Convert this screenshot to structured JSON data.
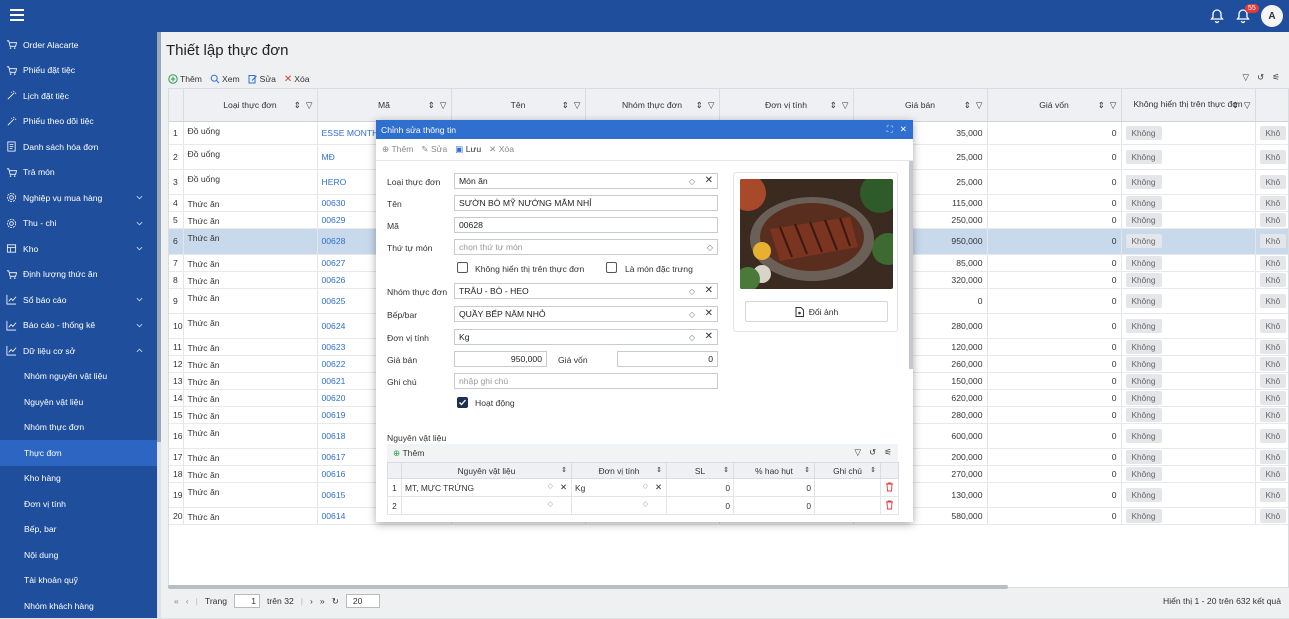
{
  "topbar": {
    "badge_count": "55",
    "avatar": "A"
  },
  "sidebar": {
    "items": [
      {
        "label": "Order Alacarte",
        "icon": "cart-icon",
        "name": "order-alacarte"
      },
      {
        "label": "Phiếu đặt tiệc",
        "icon": "cart-icon",
        "name": "phieu-dat-tiec"
      },
      {
        "label": "Lịch đặt tiệc",
        "icon": "wand-icon",
        "name": "lich-dat-tiec"
      },
      {
        "label": "Phiếu theo dõi tiệc",
        "icon": "wand-icon",
        "name": "phieu-theo-doi-tiec"
      },
      {
        "label": "Danh sách hóa đơn",
        "icon": "receipt-icon",
        "name": "danh-sach-hoa-don"
      },
      {
        "label": "Trả món",
        "icon": "cart-icon",
        "name": "tra-mon"
      },
      {
        "label": "Nghiệp vụ mua hàng",
        "icon": "gear-icon",
        "name": "nghiep-vu-mua-hang",
        "chev": "down"
      },
      {
        "label": "Thu - chi",
        "icon": "gear-icon",
        "name": "thu-chi",
        "chev": "down"
      },
      {
        "label": "Kho",
        "icon": "box-icon",
        "name": "kho",
        "chev": "down"
      },
      {
        "label": "Định lượng thức ăn",
        "icon": "cart-icon",
        "name": "dinh-luong-thuc-an"
      },
      {
        "label": "Sổ báo cáo",
        "icon": "chart-icon",
        "name": "so-bao-cao",
        "chev": "down"
      },
      {
        "label": "Báo cáo - thống kê",
        "icon": "chart-icon",
        "name": "bao-cao-thong-ke",
        "chev": "down"
      },
      {
        "label": "Dữ liệu cơ sở",
        "icon": "chart-icon",
        "name": "du-lieu-co-so",
        "chev": "up"
      }
    ],
    "subitems": [
      "Nhóm nguyên vật liệu",
      "Nguyên vật liệu",
      "Nhóm thực đơn",
      "Thực đơn",
      "Kho hàng",
      "Đơn vị tính",
      "Bếp, bar",
      "Nội dung",
      "Tài khoản quỹ",
      "Nhóm khách hàng"
    ],
    "active_sub": 3
  },
  "page": {
    "title": "Thiết lập thực đơn"
  },
  "toolbar": {
    "add": "Thêm",
    "view": "Xem",
    "edit": "Sửa",
    "delete": "Xóa"
  },
  "table": {
    "columns": [
      "Loại thực đơn",
      "Mã",
      "Tên",
      "Nhóm thực đơn",
      "Đơn vị tính",
      "Giá bán",
      "Giá vốn",
      "Không hiển thị trên thực đơn"
    ],
    "rows": [
      {
        "n": "1",
        "type": "Đồ uống",
        "code": "ESSE MONTH",
        "price": "35,000",
        "cost": "0",
        "flag": "Không"
      },
      {
        "n": "2",
        "type": "Đồ uống",
        "code": "MĐ",
        "price": "25,000",
        "cost": "0",
        "flag": "Không"
      },
      {
        "n": "3",
        "type": "Đồ uống",
        "code": "HERO",
        "price": "25,000",
        "cost": "0",
        "flag": "Không"
      },
      {
        "n": "4",
        "type": "Thức ăn",
        "code": "00630",
        "price": "115,000",
        "cost": "0",
        "flag": "Không"
      },
      {
        "n": "5",
        "type": "Thức ăn",
        "code": "00629",
        "price": "250,000",
        "cost": "0",
        "flag": "Không"
      },
      {
        "n": "6",
        "type": "Thức ăn",
        "code": "00628",
        "price": "950,000",
        "cost": "0",
        "flag": "Không"
      },
      {
        "n": "7",
        "type": "Thức ăn",
        "code": "00627",
        "price": "85,000",
        "cost": "0",
        "flag": "Không"
      },
      {
        "n": "8",
        "type": "Thức ăn",
        "code": "00626",
        "price": "320,000",
        "cost": "0",
        "flag": "Không"
      },
      {
        "n": "9",
        "type": "Thức ăn",
        "code": "00625",
        "price": "0",
        "cost": "0",
        "flag": "Không"
      },
      {
        "n": "10",
        "type": "Thức ăn",
        "code": "00624",
        "price": "280,000",
        "cost": "0",
        "flag": "Không"
      },
      {
        "n": "11",
        "type": "Thức ăn",
        "code": "00623",
        "price": "120,000",
        "cost": "0",
        "flag": "Không"
      },
      {
        "n": "12",
        "type": "Thức ăn",
        "code": "00622",
        "price": "260,000",
        "cost": "0",
        "flag": "Không"
      },
      {
        "n": "13",
        "type": "Thức ăn",
        "code": "00621",
        "price": "150,000",
        "cost": "0",
        "flag": "Không"
      },
      {
        "n": "14",
        "type": "Thức ăn",
        "code": "00620",
        "price": "620,000",
        "cost": "0",
        "flag": "Không"
      },
      {
        "n": "15",
        "type": "Thức ăn",
        "code": "00619",
        "price": "280,000",
        "cost": "0",
        "flag": "Không"
      },
      {
        "n": "16",
        "type": "Thức ăn",
        "code": "00618",
        "price": "600,000",
        "cost": "0",
        "flag": "Không"
      },
      {
        "n": "17",
        "type": "Thức ăn",
        "code": "00617",
        "price": "200,000",
        "cost": "0",
        "flag": "Không"
      },
      {
        "n": "18",
        "type": "Thức ăn",
        "code": "00616",
        "price": "270,000",
        "cost": "0",
        "flag": "Không"
      },
      {
        "n": "19",
        "type": "Thức ăn",
        "code": "00615",
        "price": "130,000",
        "cost": "0",
        "flag": "Không"
      },
      {
        "n": "20",
        "type": "Thức ăn",
        "code": "00614",
        "price": "580,000",
        "cost": "0",
        "flag": "Không"
      }
    ],
    "selected_row": 5,
    "extra_col": "Khô"
  },
  "pager": {
    "page_label": "Trang",
    "page": "1",
    "of_label": "trên 32",
    "page_size": "20",
    "summary": "Hiển thị 1 - 20 trên 632 kết quả"
  },
  "modal": {
    "title": "Chỉnh sửa thông tin",
    "toolbar": {
      "add": "Thêm",
      "edit": "Sửa",
      "save": "Lưu",
      "delete": "Xóa"
    },
    "labels": {
      "type": "Loại thực đơn",
      "name": "Tên",
      "code": "Mã",
      "order": "Thứ tự món",
      "group": "Nhóm thực đơn",
      "kitchen": "Bếp/bar",
      "unit": "Đơn vị tính",
      "price": "Giá bán",
      "cost": "Giá vốn",
      "note": "Ghi chú",
      "hide": "Không hiển thị trên thực đơn",
      "special": "Là món đặc trưng",
      "active": "Hoạt động",
      "materials": "Nguyên vật liệu",
      "change_image": "Đổi ảnh"
    },
    "values": {
      "type": "Món ăn",
      "name": "SƯỜN BÒ MỸ NƯỚNG MẮM NHỈ",
      "code": "00628",
      "order_placeholder": "chọn thứ tự món",
      "group": "TRÂU - BÒ - HEO",
      "kitchen": "QUẦY BẾP NĂM NHỎ",
      "unit": "Kg",
      "price": "950,000",
      "cost": "0",
      "note_placeholder": "nhập ghi chú"
    },
    "checks": {
      "hide": false,
      "special": false,
      "active": true
    },
    "materials": {
      "add": "Thêm",
      "columns": [
        "Nguyên vật liệu",
        "Đơn vị tính",
        "SL",
        "% hao hụt",
        "Ghi chú"
      ],
      "rows": [
        {
          "n": "1",
          "item": "MT, MỰC TRỨNG",
          "unit": "Kg",
          "qty": "0",
          "loss": "0",
          "note": ""
        },
        {
          "n": "2",
          "item": "",
          "unit": "",
          "qty": "0",
          "loss": "0",
          "note": ""
        }
      ]
    }
  }
}
